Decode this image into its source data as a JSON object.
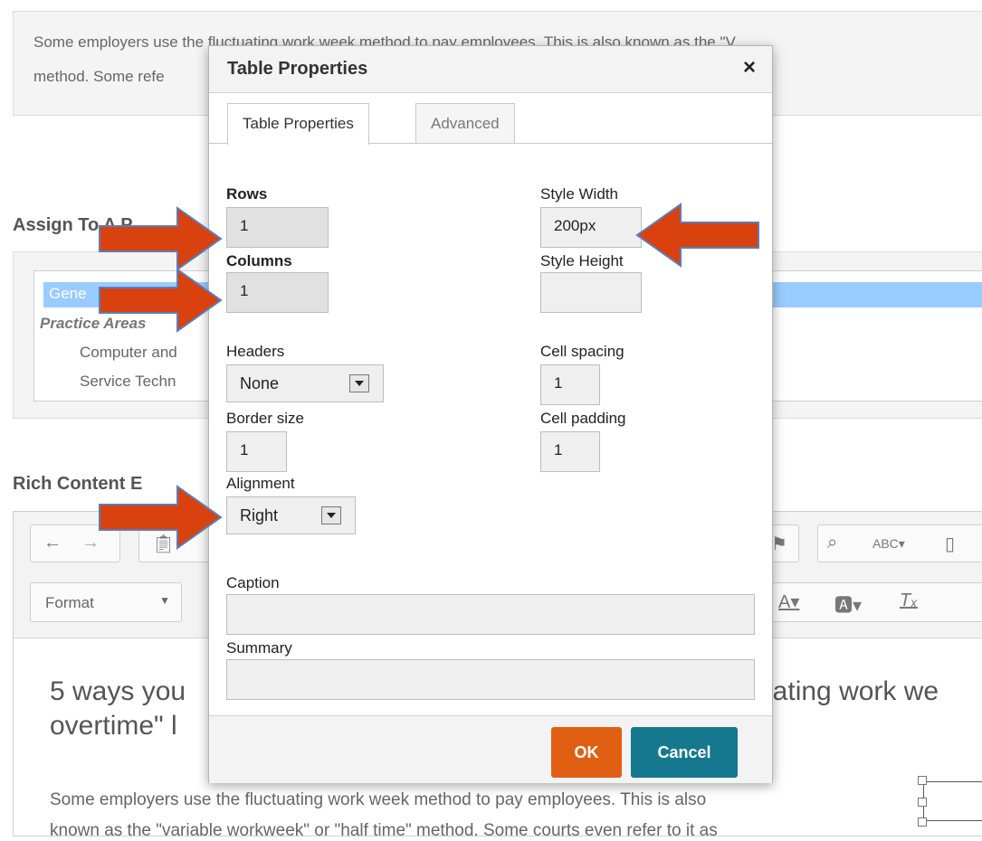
{
  "background": {
    "top_text_line1": "Some employers use the fluctuating work week method to pay employees. This is also known as the \"V",
    "top_text_line2": "method. Some refe",
    "assign_heading": "Assign To A P",
    "assign_selected": "Gene",
    "assign_group": "Practice Areas",
    "assign_item1": "Computer and",
    "assign_item2": "Service Techn",
    "rce_heading": "Rich Content E",
    "format_label": "Format",
    "content_heading_line1_left": "5 ways you",
    "content_heading_line1_right": "uating work we",
    "content_heading_line2": "overtime\" l",
    "content_para_line1": "Some employers use the fluctuating work week method to pay employees. This is also",
    "content_para_line2": "known as the \"variable workweek\" or \"half time\" method. Some courts even refer to it as"
  },
  "dialog": {
    "title": "Table Properties",
    "close_glyph": "×",
    "tabs": [
      {
        "label": "Table Properties"
      },
      {
        "label": "Advanced"
      }
    ],
    "rows_label": "Rows",
    "rows_value": "1",
    "columns_label": "Columns",
    "columns_value": "1",
    "style_width_label": "Style Width",
    "style_width_value": "200px",
    "style_height_label": "Style Height",
    "style_height_value": "",
    "headers_label": "Headers",
    "headers_value": "None",
    "cell_spacing_label": "Cell spacing",
    "cell_spacing_value": "1",
    "border_size_label": "Border size",
    "border_size_value": "1",
    "cell_padding_label": "Cell padding",
    "cell_padding_value": "1",
    "alignment_label": "Alignment",
    "alignment_value": "Right",
    "caption_label": "Caption",
    "caption_value": "",
    "summary_label": "Summary",
    "summary_value": "",
    "ok_label": "OK",
    "cancel_label": "Cancel"
  },
  "colors": {
    "arrow": "#d9410e",
    "ok_button": "#e15f13",
    "cancel_button": "#15788e",
    "selection": "#99ccff"
  }
}
